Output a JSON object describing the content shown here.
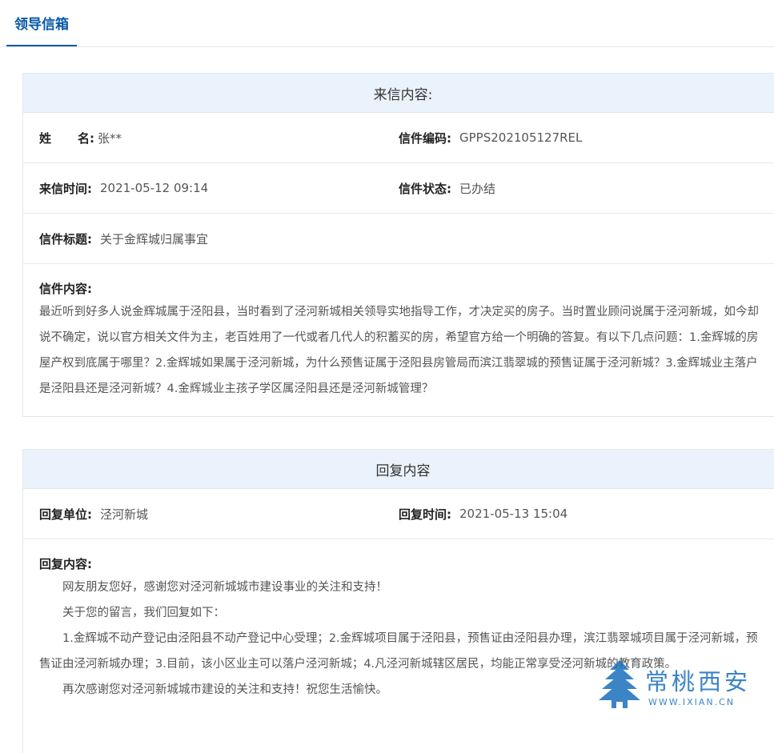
{
  "tab": {
    "active_label": "领导信箱"
  },
  "letter": {
    "header": "来信内容:",
    "name_label_a": "姓",
    "name_label_b": "名:",
    "name_value": "张**",
    "code_label": "信件编码:",
    "code_value": "GPPS202105127REL",
    "time_label": "来信时间:",
    "time_value": "2021-05-12 09:14",
    "status_label": "信件状态:",
    "status_value": "已办结",
    "subject_label": "信件标题:",
    "subject_value": "关于金辉城归属事宜",
    "content_label": "信件内容:",
    "content_text": "最近听到好多人说金辉城属于泾阳县，当时看到了泾河新城相关领导实地指导工作，才决定买的房子。当时置业顾问说属于泾河新城，如今却说不确定，说以官方相关文件为主，老百姓用了一代或者几代人的积蓄买的房，希望官方给一个明确的答复。有以下几点问题：1.金辉城的房屋产权到底属于哪里？2.金辉城如果属于泾河新城，为什么预售证属于泾阳县房管局而滨江翡翠城的预售证属于泾河新城？3.金辉城业主落户是泾阳县还是泾河新城？4.金辉城业主孩子学区属泾阳县还是泾河新城管理？"
  },
  "reply": {
    "header": "回复内容",
    "unit_label": "回复单位:",
    "unit_value": "泾河新城",
    "time_label": "回复时间:",
    "time_value": "2021-05-13 15:04",
    "content_label": "回复内容:",
    "paragraphs": [
      "网友朋友您好，感谢您对泾河新城城市建设事业的关注和支持！",
      "关于您的留言，我们回复如下：",
      "1.金辉城不动产登记由泾阳县不动产登记中心受理；2.金辉城项目属于泾阳县，预售证由泾阳县办理，滨江翡翠城项目属于泾河新城，预售证由泾河新城办理；3.目前，该小区业主可以落户泾河新城；4.凡泾河新城辖区居民，均能正常享受泾河新城的教育政策。",
      "再次感谢您对泾河新城城市建设的关注和支持！祝您生活愉快。"
    ]
  },
  "watermark": {
    "text_cn": "常桃西安",
    "url": "WWW.IXIAN.CN",
    "color": "#1a6fbd"
  }
}
